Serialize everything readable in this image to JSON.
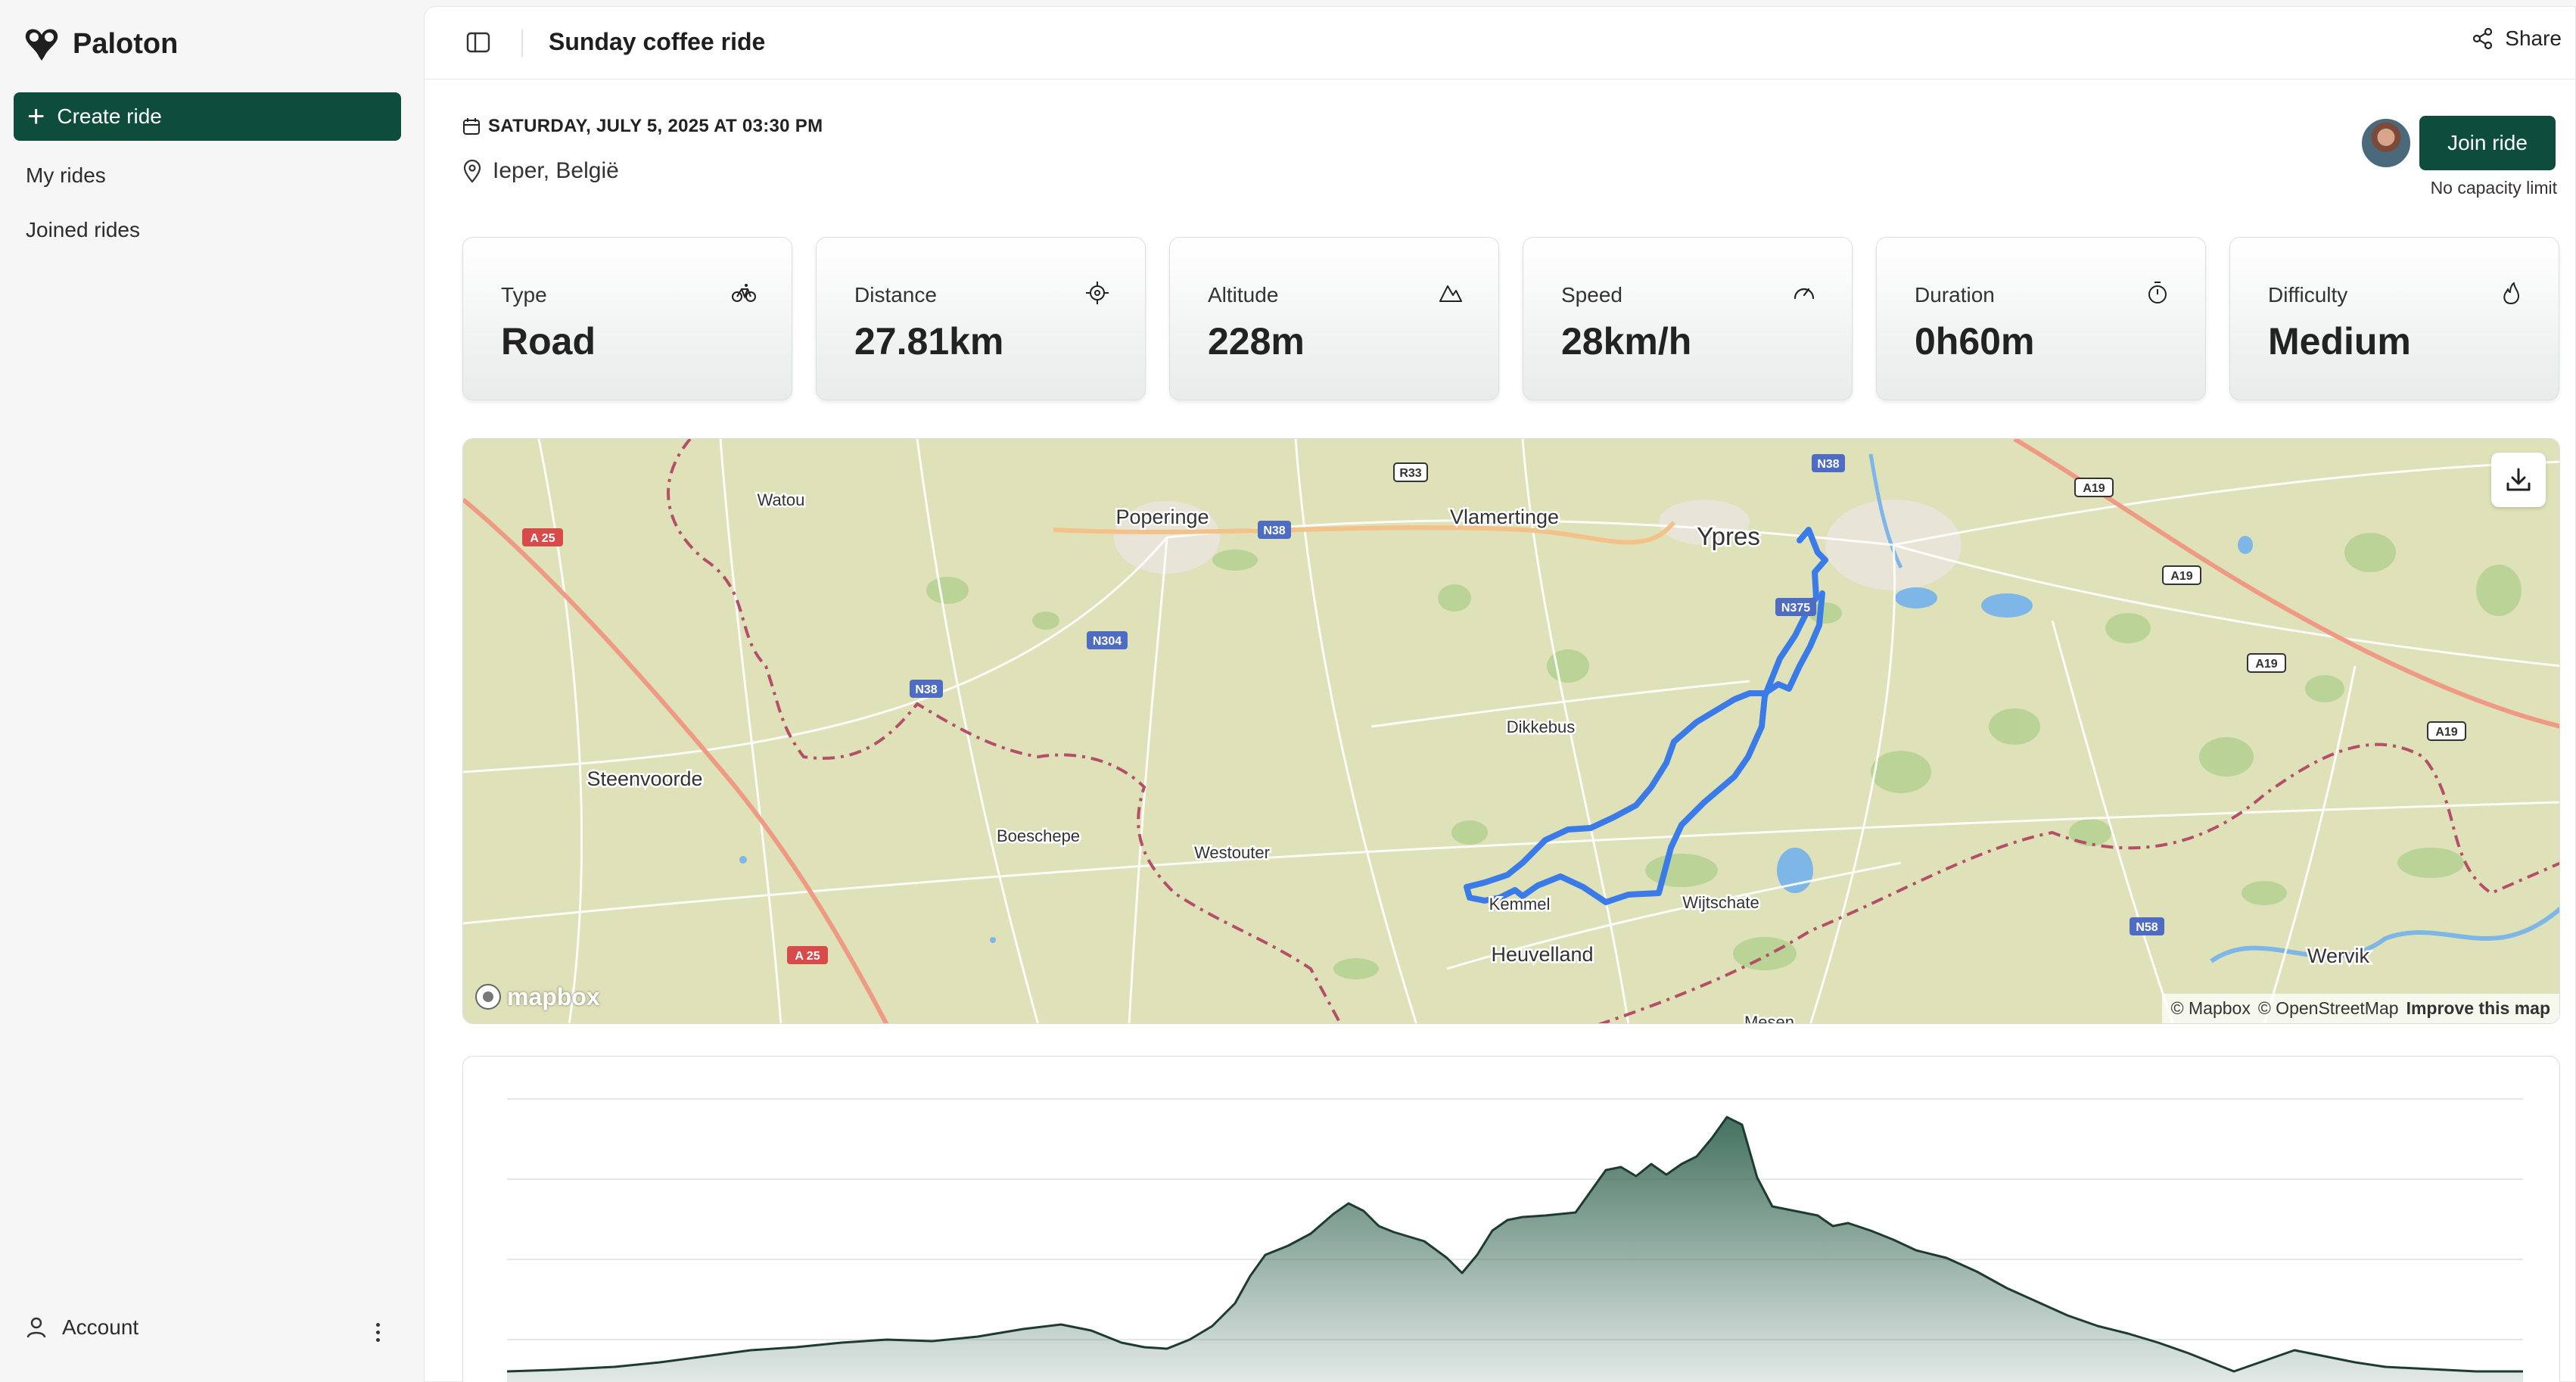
{
  "app": {
    "name": "Paloton"
  },
  "sidebar": {
    "create_label": "Create ride",
    "items": [
      {
        "label": "My rides"
      },
      {
        "label": "Joined rides"
      }
    ],
    "account_label": "Account"
  },
  "header": {
    "title": "Sunday coffee ride",
    "share_label": "Share"
  },
  "ride": {
    "date": "SATURDAY, JULY 5, 2025 AT 03:30 PM",
    "location": "Ieper, België",
    "join_label": "Join ride",
    "capacity": "No capacity limit"
  },
  "stats": [
    {
      "label": "Type",
      "value": "Road",
      "icon": "bicycle-icon"
    },
    {
      "label": "Distance",
      "value": "27.81km",
      "icon": "crosshair-icon"
    },
    {
      "label": "Altitude",
      "value": "228m",
      "icon": "mountain-icon"
    },
    {
      "label": "Speed",
      "value": "28km/h",
      "icon": "gauge-icon"
    },
    {
      "label": "Duration",
      "value": "0h60m",
      "icon": "stopwatch-icon"
    },
    {
      "label": "Difficulty",
      "value": "Medium",
      "icon": "flame-icon"
    }
  ],
  "map": {
    "places": [
      {
        "name": "Watou"
      },
      {
        "name": "Poperinge"
      },
      {
        "name": "Vlamertinge"
      },
      {
        "name": "Ypres"
      },
      {
        "name": "Steenvoorde"
      },
      {
        "name": "Boeschepe"
      },
      {
        "name": "Westouter"
      },
      {
        "name": "Dikkebus"
      },
      {
        "name": "Kemmel"
      },
      {
        "name": "Heuvelland"
      },
      {
        "name": "Wijtschate"
      },
      {
        "name": "Wervik"
      },
      {
        "name": "Mesen"
      }
    ],
    "shields": [
      "R33",
      "N38",
      "N38",
      "N304",
      "N38",
      "N375",
      "A19",
      "A19",
      "A19",
      "A19",
      "A 25",
      "A 25",
      "N58"
    ],
    "logo_text": "mapbox",
    "attribution": [
      "© Mapbox",
      "© OpenStreetMap",
      "Improve this map"
    ],
    "colors": {
      "route": "#3b7be8",
      "land": "#dfe1b8",
      "forest": "#b4d08f",
      "water": "#7fb6e8",
      "motorway": "#ef9a84",
      "border": "#b44f6a"
    }
  },
  "elevation": {
    "colors": {
      "fill": "#3a6a58",
      "line": "#1e3b30"
    }
  },
  "theme": {
    "primary": "#0e4d3c"
  }
}
